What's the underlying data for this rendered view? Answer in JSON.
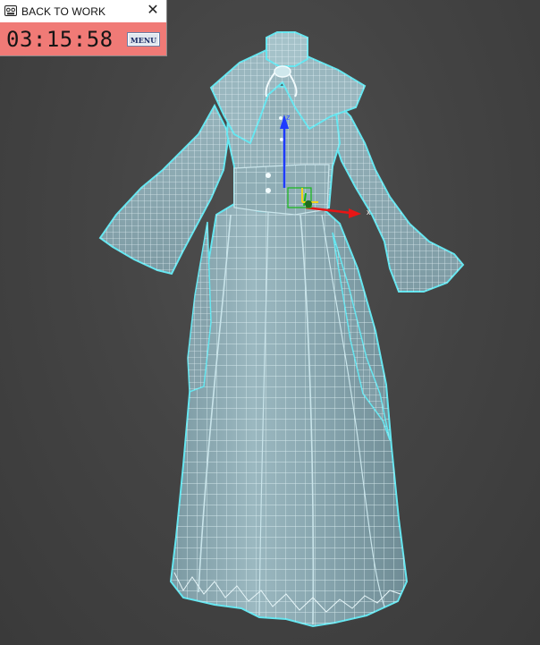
{
  "timer_window": {
    "title": "BACK TO WORK",
    "time": "03:15:58",
    "menu_label": "MENU",
    "close_glyph": "✕",
    "app_icon": "cassette-icon",
    "body_color": "#f07a76"
  },
  "viewport": {
    "background_color": "#444444",
    "model_color": "#8fadb5",
    "wire_color": "#dff2f6",
    "selection_color": "#65e6f0",
    "gizmo": {
      "z_label": "z",
      "x_label": "x",
      "z_color": "#1e3bff",
      "x_color": "#e81515",
      "y_color": "#18b818"
    }
  }
}
